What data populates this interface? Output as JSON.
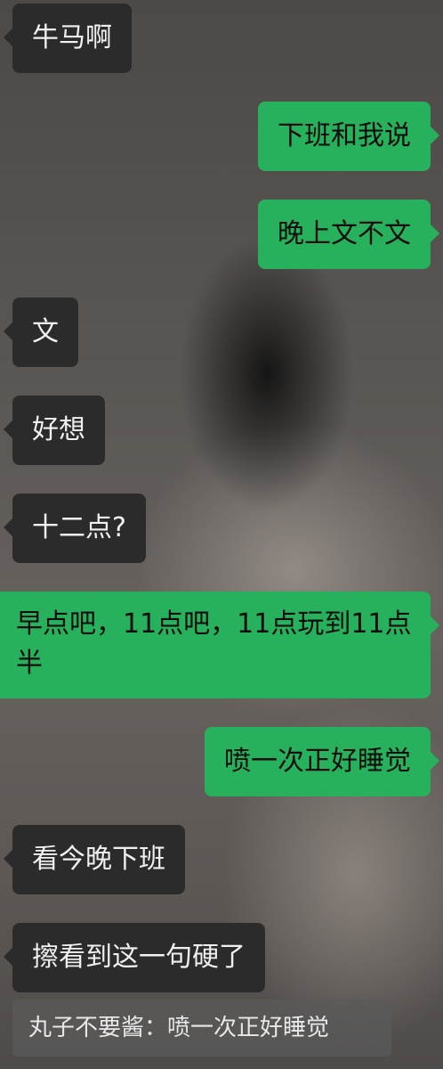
{
  "messages": [
    {
      "side": "left",
      "text": "牛马啊"
    },
    {
      "side": "right",
      "text": "下班和我说"
    },
    {
      "side": "right",
      "text": "晚上文不文"
    },
    {
      "side": "left",
      "text": "文"
    },
    {
      "side": "left",
      "text": "好想"
    },
    {
      "side": "left",
      "text": "十二点?"
    },
    {
      "side": "right",
      "text": "早点吧，11点吧，11点玩到11点半"
    },
    {
      "side": "right",
      "text": "喷一次正好睡觉"
    },
    {
      "side": "left",
      "text": "看今晚下班"
    },
    {
      "side": "left",
      "text": "擦看到这一句硬了"
    }
  ],
  "quote": {
    "text": "丸子不要酱：喷一次正好睡觉"
  },
  "colors": {
    "sent_bubble": "#28b15c",
    "received_bubble": "#2b2b2b"
  }
}
